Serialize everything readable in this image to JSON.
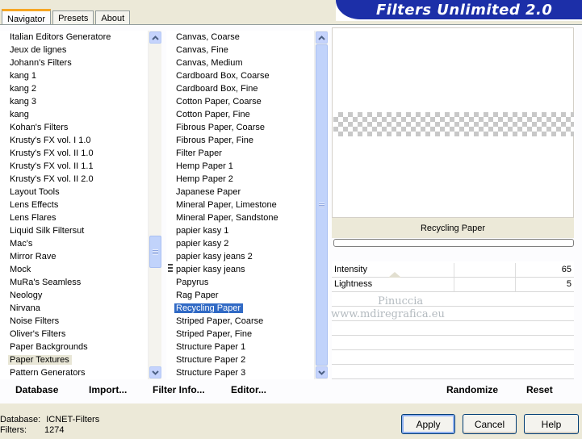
{
  "tabs": [
    "Navigator",
    "Presets",
    "About"
  ],
  "banner_title": "Filters Unlimited 2.0",
  "categories": [
    "Italian Editors Generatore",
    "Jeux de lignes",
    "Johann's Filters",
    "kang 1",
    "kang 2",
    "kang 3",
    "kang",
    "Kohan's Filters",
    "Krusty's FX vol. I 1.0",
    "Krusty's FX vol. II 1.0",
    "Krusty's FX vol. II 1.1",
    "Krusty's FX vol. II 2.0",
    "Layout Tools",
    "Lens Effects",
    "Lens Flares",
    "Liquid Silk Filtersut",
    "Mac's",
    "Mirror Rave",
    "Mock",
    "MuRa's Seamless",
    "Neology",
    "Nirvana",
    "Noise Filters",
    "Oliver's Filters",
    "Paper Backgrounds",
    "Paper Textures",
    "Pattern Generators"
  ],
  "selected_category": "Paper Textures",
  "filters": [
    "Canvas, Coarse",
    "Canvas, Fine",
    "Canvas, Medium",
    "Cardboard Box, Coarse",
    "Cardboard Box, Fine",
    "Cotton Paper, Coarse",
    "Cotton Paper, Fine",
    "Fibrous Paper, Coarse",
    "Fibrous Paper, Fine",
    "Filter Paper",
    "Hemp Paper 1",
    "Hemp Paper 2",
    "Japanese Paper",
    "Mineral Paper, Limestone",
    "Mineral Paper, Sandstone",
    "papier kasy 1",
    "papier kasy 2",
    "papier kasy jeans 2",
    "papier kasy jeans",
    "Papyrus",
    "Rag Paper",
    "Recycling Paper",
    "Striped Paper, Coarse",
    "Striped Paper, Fine",
    "Structure Paper 1",
    "Structure Paper 2",
    "Structure Paper 3"
  ],
  "selected_filter": "Recycling Paper",
  "left_buttons": {
    "database": "Database",
    "import": "Import...",
    "filter_info": "Filter Info...",
    "editor": "Editor..."
  },
  "current_filter_name": "Recycling Paper",
  "params": [
    {
      "label": "Intensity",
      "value": "65"
    },
    {
      "label": "Lightness",
      "value": "5"
    }
  ],
  "watermark": [
    "Pinuccia",
    "www.mdiregrafica.eu"
  ],
  "right_buttons": {
    "randomize": "Randomize",
    "reset": "Reset"
  },
  "status": {
    "database_label": "Database:",
    "database_value": "ICNET-Filters",
    "filters_label": "Filters:",
    "filters_value": "1274"
  },
  "dialog_buttons": {
    "apply": "Apply",
    "cancel": "Cancel",
    "help": "Help"
  },
  "colors": {
    "banner": "#1c2fa8",
    "selection": "#316ac5",
    "tab_highlight": "#f6a623"
  }
}
